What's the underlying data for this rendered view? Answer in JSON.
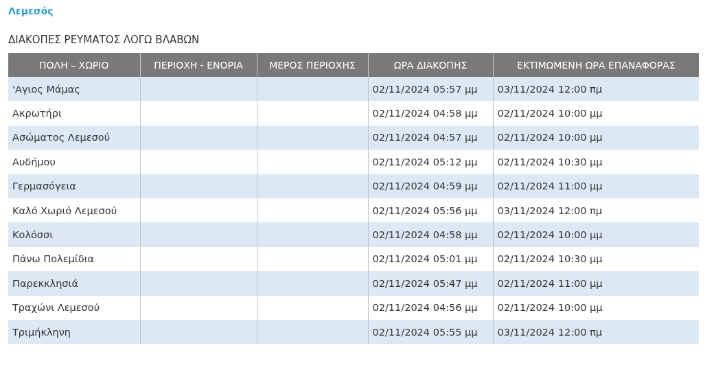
{
  "region_title": "Λεμεσός",
  "section_title": "ΔΙΑΚΟΠΕΣ ΡΕΥΜΑΤΟΣ ΛΟΓΩ ΒΛΑΒΩΝ",
  "table": {
    "columns": [
      "ΠΟΛΗ – ΧΩΡΙΟ",
      "ΠΕΡΙΟΧΗ - ΕΝΟΡΙΑ",
      "ΜΕΡΟΣ ΠΕΡΙΟΧΗΣ",
      "ΩΡΑ ΔΙΑΚΟΠΗΣ",
      "ΕΚΤΙΜΩΜΕΝΗ ΩΡΑ ΕΠΑΝΑΦΟΡΑΣ"
    ],
    "rows": [
      {
        "place": "'Αγιος Μάμας",
        "outage_time": "02/11/2024 05:57 μμ",
        "restore_time": "03/11/2024 12:00 πμ"
      },
      {
        "place": "Ακρωτήρι",
        "outage_time": "02/11/2024 04:58 μμ",
        "restore_time": "02/11/2024 10:00 μμ"
      },
      {
        "place": "Ασώματος Λεμεσού",
        "outage_time": "02/11/2024 04:57 μμ",
        "restore_time": "02/11/2024 10:00 μμ"
      },
      {
        "place": "Αυδήμου",
        "outage_time": "02/11/2024 05:12 μμ",
        "restore_time": "02/11/2024 10:30 μμ"
      },
      {
        "place": "Γερμασόγεια",
        "outage_time": "02/11/2024 04:59 μμ",
        "restore_time": "02/11/2024 11:00 μμ"
      },
      {
        "place": "Καλό Χωριό Λεμεσού",
        "outage_time": "02/11/2024 05:56 μμ",
        "restore_time": "03/11/2024 12:00 πμ"
      },
      {
        "place": "Κολόσσι",
        "outage_time": "02/11/2024 04:58 μμ",
        "restore_time": "02/11/2024 10:00 μμ"
      },
      {
        "place": "Πάνω Πολεμίδια",
        "outage_time": "02/11/2024 05:01 μμ",
        "restore_time": "02/11/2024 10:30 μμ"
      },
      {
        "place": "Παρεκκλησιά",
        "outage_time": "02/11/2024 05:47 μμ",
        "restore_time": "02/11/2024 11:00 μμ"
      },
      {
        "place": "Τραχώνι Λεμεσού",
        "outage_time": "02/11/2024 04:56 μμ",
        "restore_time": "02/11/2024 10:00 μμ"
      },
      {
        "place": "Τριμήκληνη",
        "outage_time": "02/11/2024 05:55 μμ",
        "restore_time": "03/11/2024 12:00 πμ"
      }
    ]
  }
}
